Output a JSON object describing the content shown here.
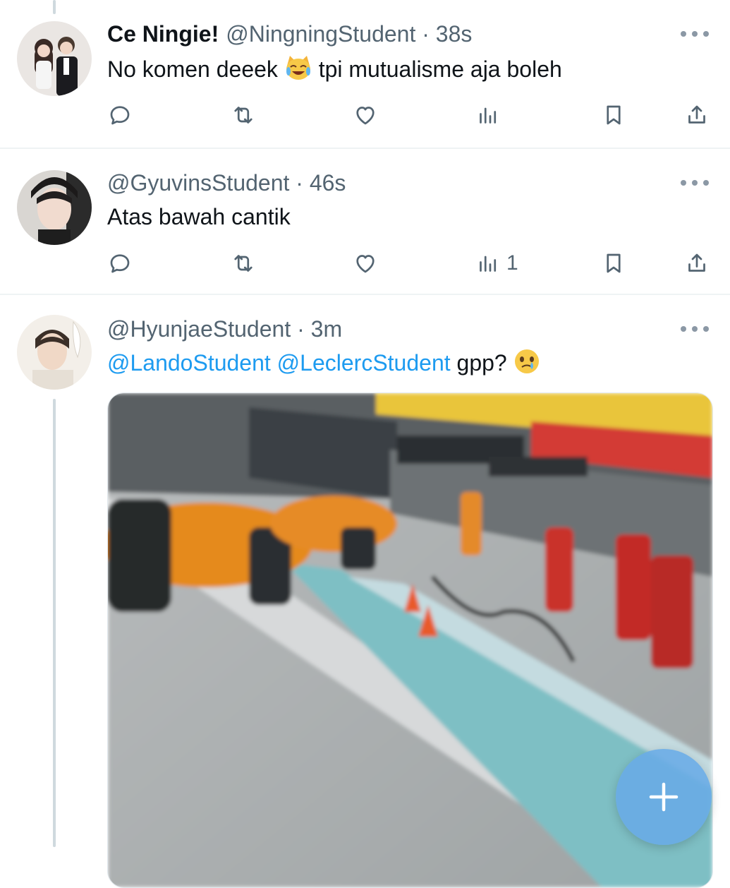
{
  "colors": {
    "accent": "#1d9bf0",
    "muted": "#536471",
    "fab": "#69abe6"
  },
  "tweets": [
    {
      "display_name": "Ce Ningie!",
      "handle": "@NingningStudent",
      "separator": "·",
      "time": "38s",
      "text_before": "No komen deeek ",
      "emoji": "crying-laughing-cat",
      "text_after": " tpi mutualisme aja boleh",
      "views": ""
    },
    {
      "handle": "@GyuvinsStudent",
      "separator": "·",
      "time": "46s",
      "text": "Atas bawah cantik",
      "views": "1"
    },
    {
      "handle": "@HyunjaeStudent",
      "separator": "·",
      "time": "3m",
      "mention_1": "@LandoStudent",
      "mention_2": "@LeclercStudent",
      "text_after": " gpp? ",
      "emoji": "holding-back-tears-face",
      "media": "pit-lane-video"
    }
  ],
  "icons": [
    "reply-icon",
    "retweet-icon",
    "like-icon",
    "views-icon",
    "bookmark-icon",
    "share-icon",
    "more-icon",
    "compose-plus-icon"
  ]
}
